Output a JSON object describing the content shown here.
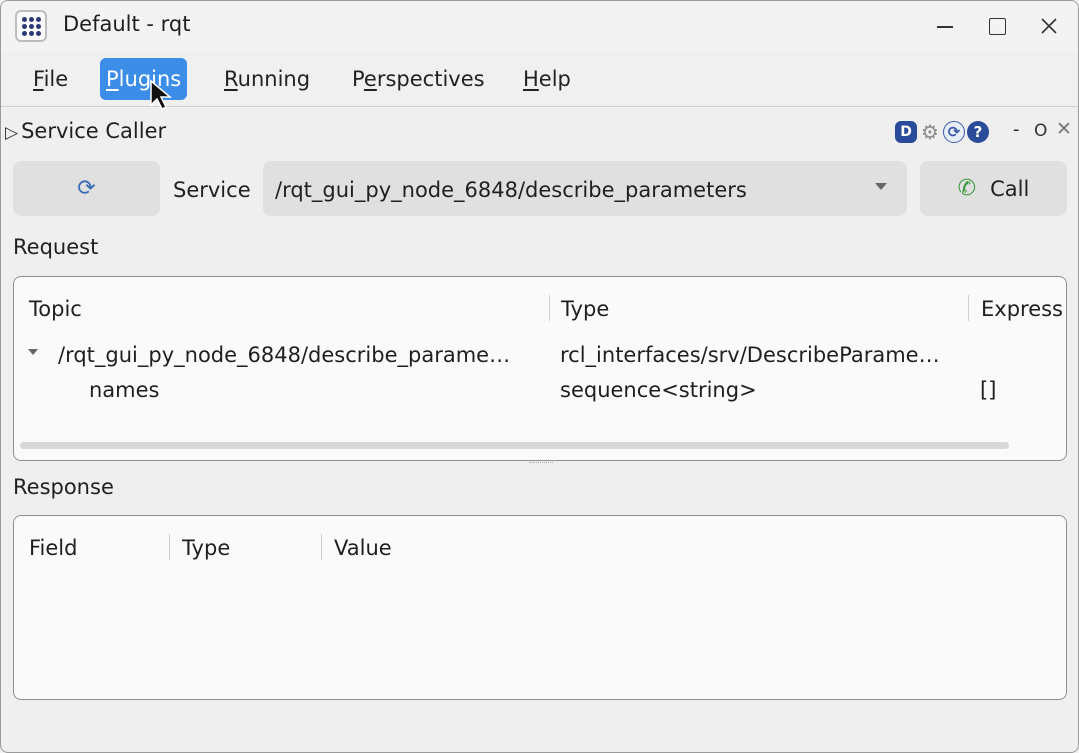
{
  "window": {
    "title": "Default - rqt"
  },
  "menu": {
    "items": [
      {
        "label": "File",
        "accel": "F",
        "rest": "ile"
      },
      {
        "label": "Plugins",
        "accel": "P",
        "rest": "lugins"
      },
      {
        "label": "Running",
        "accel": "R",
        "rest": "unning"
      },
      {
        "label": "Perspectives",
        "pre": "P",
        "accel": "e",
        "rest": "rspectives"
      },
      {
        "label": "Help",
        "accel": "H",
        "rest": "elp"
      }
    ],
    "active": "Plugins"
  },
  "plugin": {
    "title": "Service Caller",
    "header_icons": [
      "d-icon",
      "gear-icon",
      "refresh-icon",
      "help-icon"
    ],
    "dash": "-",
    "o": "O",
    "x": "✕"
  },
  "service_row": {
    "service_label": "Service",
    "service_value": "/rqt_gui_py_node_6848/describe_parameters",
    "call_label": "Call"
  },
  "request": {
    "label": "Request",
    "columns": [
      "Topic",
      "Type",
      "Express"
    ],
    "rows": [
      {
        "topic": "/rqt_gui_py_node_6848/describe_parame…",
        "type": "rcl_interfaces/srv/DescribeParame…",
        "expression": ""
      },
      {
        "topic": "names",
        "type": "sequence<string>",
        "expression": "[]"
      }
    ]
  },
  "response": {
    "label": "Response",
    "columns": [
      "Field",
      "Type",
      "Value"
    ],
    "rows": []
  },
  "colors": {
    "accent": "#3c8de8",
    "button_bg": "#e0e0e0",
    "phone_green": "#3a9a3a"
  }
}
